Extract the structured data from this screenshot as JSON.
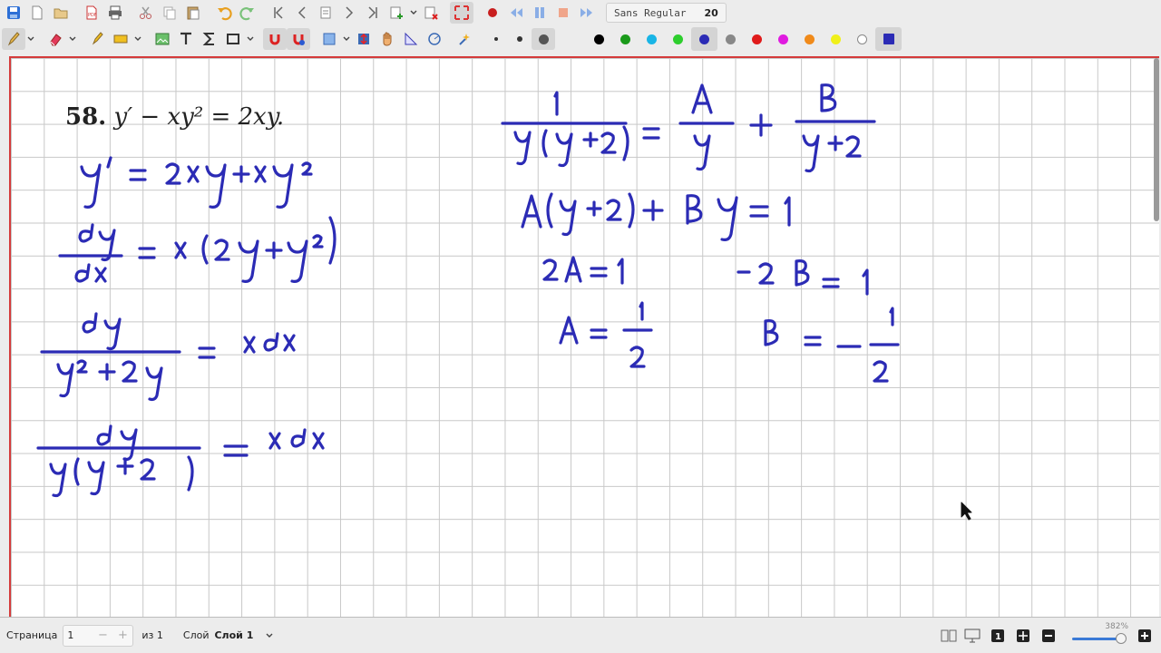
{
  "toolbar": {
    "font_name": "Sans Regular",
    "font_size": "20",
    "icons_row1": [
      "save-icon",
      "new-page-icon",
      "open-icon",
      "export-pdf-icon",
      "print-icon",
      "cut-icon",
      "copy-icon",
      "paste-icon",
      "undo-icon",
      "redo-icon",
      "first-page-icon",
      "prev-page-icon",
      "goto-page-icon",
      "next-page-icon",
      "last-page-icon",
      "add-page-icon",
      "delete-page-icon",
      "fullscreen-icon",
      "record-icon",
      "rewind-icon",
      "pause-icon",
      "stop-icon",
      "forward-icon"
    ],
    "colors": [
      "#000000",
      "#1a9a1a",
      "#19b5e6",
      "#2dce2d",
      "#2b2bb5",
      "#888888",
      "#e01b1b",
      "#e01be0",
      "#f08a1a",
      "#f0f01a",
      "#ffffff"
    ]
  },
  "problem": {
    "number": "58.",
    "equation": "y′ − xy² = 2xy."
  },
  "status": {
    "page_label": "Страница",
    "page_value": "1",
    "page_minus": "−",
    "page_plus": "+",
    "of_label": "из 1",
    "layer_label": "Слой",
    "layer_value": "Слой 1",
    "zoom": "382%"
  }
}
